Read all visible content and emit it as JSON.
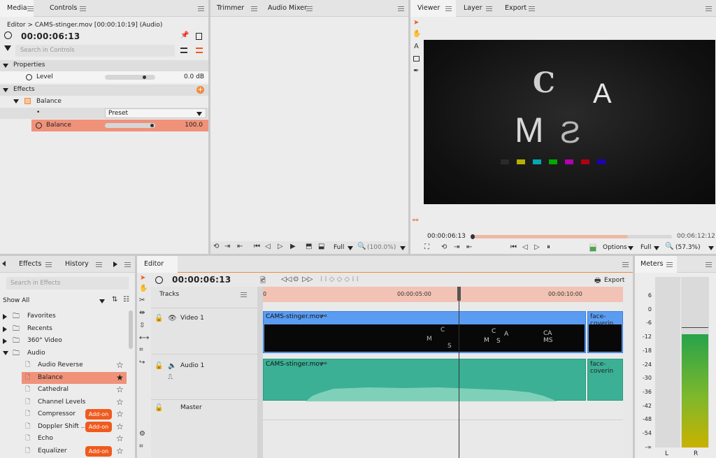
{
  "top_left": {
    "tabs": [
      "Media",
      "Controls"
    ],
    "breadcrumb": "Editor > CAMS-stinger.mov [00:00:10:19] (Audio)",
    "timecode": "00:00:06:13",
    "search_placeholder": "Search in Controls",
    "properties_label": "Properties",
    "level_label": "Level",
    "level_value": "0.0 dB",
    "effects_label": "Effects",
    "balance_label": "Balance",
    "preset_label": "Preset",
    "balance_param_label": "Balance",
    "balance_value": "100.0"
  },
  "top_mid": {
    "tabs": [
      "Trimmer",
      "Audio Mixer"
    ],
    "zoom": "Full",
    "zoom_pct": "(100.0%)"
  },
  "viewer": {
    "tabs": [
      "Viewer",
      "Layer",
      "Export"
    ],
    "timecode_current": "00:00:06:13",
    "timecode_end": "00:06:12:12",
    "options_label": "Options",
    "quality": "Full",
    "zoom_pct": "(57.3%)",
    "letters": {
      "c": "C",
      "a": "A",
      "m": "M",
      "s": "S"
    },
    "color_bars": [
      "#2a2a2a",
      "#b5b000",
      "#00a8b0",
      "#00a800",
      "#b000b0",
      "#b00010",
      "#2000b0"
    ],
    "progress": 0.78
  },
  "effects_panel": {
    "tabs": [
      "Effects",
      "History"
    ],
    "search_placeholder": "Search in Effects",
    "filter": "Show All",
    "tree": [
      {
        "label": "Favorites",
        "open": false
      },
      {
        "label": "Recents",
        "open": false
      },
      {
        "label": "360° Video",
        "open": false
      },
      {
        "label": "Audio",
        "open": true
      }
    ],
    "items": [
      {
        "label": "Audio Reverse",
        "addon": false,
        "starred": false
      },
      {
        "label": "Balance",
        "addon": false,
        "starred": true,
        "selected": true
      },
      {
        "label": "Cathedral",
        "addon": false,
        "starred": false
      },
      {
        "label": "Channel Levels",
        "addon": false,
        "starred": false
      },
      {
        "label": "Compressor",
        "addon": true,
        "starred": false
      },
      {
        "label": "Doppler Shift ...",
        "addon": true,
        "starred": false
      },
      {
        "label": "Echo",
        "addon": false,
        "starred": false
      },
      {
        "label": "Equalizer",
        "addon": true,
        "starred": false
      }
    ],
    "addon_label": "Add-on"
  },
  "editor": {
    "tab": "Editor",
    "timecode": "00:00:06:13",
    "export_label": "Export",
    "tracks_label": "Tracks",
    "ruler": [
      "0",
      "00:00:05:00",
      "00:00:10:00"
    ],
    "video_track": "Video 1",
    "audio_track": "Audio 1",
    "master_track": "Master",
    "clip_video": "CAMS-stinger.mov",
    "clip_audio": "CAMS-stinger.mov",
    "clip_next": "face-coverin"
  },
  "meters": {
    "tab": "Meters",
    "peak": "-9",
    "scale": [
      "6",
      "0",
      "-6",
      "-12",
      "-18",
      "-24",
      "-30",
      "-36",
      "-42",
      "-48",
      "-54",
      "-∞"
    ],
    "channels": [
      "L",
      "R"
    ],
    "level_r": 0.8
  }
}
